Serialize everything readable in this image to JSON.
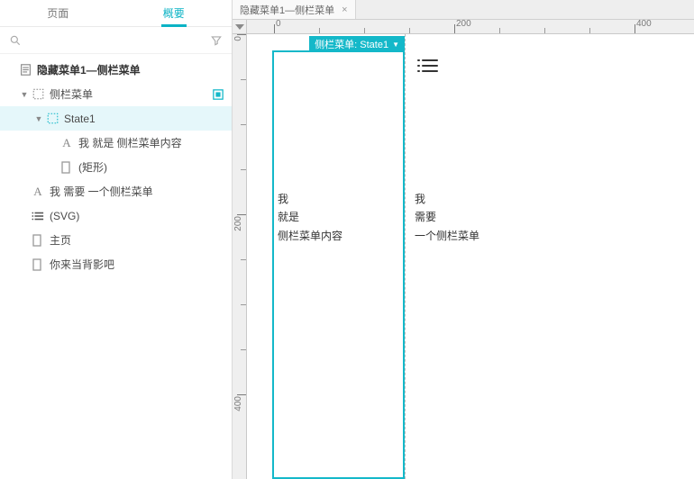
{
  "sidebar": {
    "tabs": {
      "pages": "页面",
      "outline": "概要"
    },
    "root": "隐藏菜单1—侧栏菜单",
    "items": [
      {
        "label": "侧栏菜单",
        "level": 1,
        "caret": "down",
        "icon": "dashed-box",
        "state": "target"
      },
      {
        "label": "State1",
        "level": 2,
        "caret": "down",
        "icon": "dashed-box",
        "selected": true
      },
      {
        "label": "我 就是 侧栏菜单内容",
        "level": 3,
        "caret": "none",
        "icon": "text-a"
      },
      {
        "label": "(矩形)",
        "level": 3,
        "caret": "none",
        "icon": "rect"
      },
      {
        "label": "我 需要 一个侧栏菜单",
        "level": 1,
        "caret": "none",
        "icon": "text-a"
      },
      {
        "label": "(SVG)",
        "level": 1,
        "caret": "none",
        "icon": "list"
      },
      {
        "label": "主页",
        "level": 1,
        "caret": "none",
        "icon": "rect"
      },
      {
        "label": "你来当背影吧",
        "level": 1,
        "caret": "none",
        "icon": "rect"
      }
    ]
  },
  "workspace": {
    "tab": "隐藏菜单1—侧栏菜单",
    "selection_label": "侧栏菜单: State1",
    "ruler_h": [
      0,
      200,
      400
    ],
    "ruler_v": [
      0,
      200,
      400
    ],
    "text_left": "我\n就是\n侧栏菜单内容",
    "text_right": "我\n需要\n一个侧栏菜单"
  }
}
